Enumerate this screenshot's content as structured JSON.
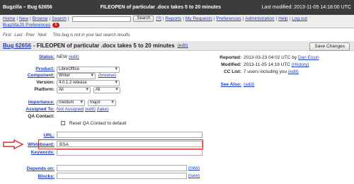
{
  "header": {
    "app_title": "Bugzilla – Bug 62656",
    "center_title": "FILEOPEN of particular .docx takes 5 to 20 minutes",
    "last_modified": "Last modified: 2013-11-05 14:18:00 UTC"
  },
  "nav": {
    "home": "Home",
    "new": "New",
    "browse": "Browse",
    "search": "Search",
    "search_button": "Search",
    "help_q": "[?]",
    "reports": "Reports",
    "my_requests": "My Requests",
    "preferences": "Preferences",
    "administration": "Administration",
    "help": "Help",
    "logout": "Log out",
    "bugzillajs": "BugzillaJS Preferences",
    "badge": "1"
  },
  "navline": {
    "first": "First",
    "last": "Last",
    "prev": "Prev",
    "next": "Next",
    "note": "This bug is not in your last search results."
  },
  "bug": {
    "id": "Bug 62656",
    "summary": " - FILEOPEN of particular .docx takes 5 to 20 minutes",
    "edit": "(edit)",
    "save": "Save Changes"
  },
  "fields": {
    "status_label": "Status:",
    "status_value": "NEW",
    "status_edit": "(edit)",
    "product_label": "Product:",
    "product_value": "LibreOffice",
    "component_label": "Component:",
    "component_value": "Writer",
    "component_browse": "(browse)",
    "version_label": "Version:",
    "version_value": "4.0.1.2 release",
    "platform_label": "Platform:",
    "platform_value1": "All",
    "platform_value2": "All",
    "importance_label": "Importance:",
    "importance_value1": "medium",
    "importance_value2": "major",
    "assigned_label": "Assigned To:",
    "assigned_value": "Not Assigned",
    "assigned_edit": "(edit)",
    "assigned_take": "(take)",
    "qa_label": "QA Contact:",
    "qa_reset": "Reset QA Contact to default",
    "url_label": "URL:",
    "whiteboard_label": "Whiteboard:",
    "whiteboard_value": "BSA",
    "keywords_label": "Keywords:",
    "depends_label": "Depends on:",
    "depends_new": "(new)",
    "blocks_label": "Blocks:",
    "blocks_new": "(new)"
  },
  "side": {
    "reported_label": "Reported:",
    "reported_value": "2013-03-23 04:02 UTC by",
    "reported_by": "Dan Essin",
    "modified_label": "Modified:",
    "modified_value": "2013-11-05 14:18 UTC",
    "history": "(History)",
    "cc_label": "CC List:",
    "cc_value": "7 users including you",
    "cc_edit": "(edit)",
    "see_also_label": "See Also:",
    "see_also_add": "(add)"
  },
  "colors": {
    "highlight": "#d0312d",
    "header_bg": "#3c3c3c",
    "link": "#1f3fbf"
  }
}
